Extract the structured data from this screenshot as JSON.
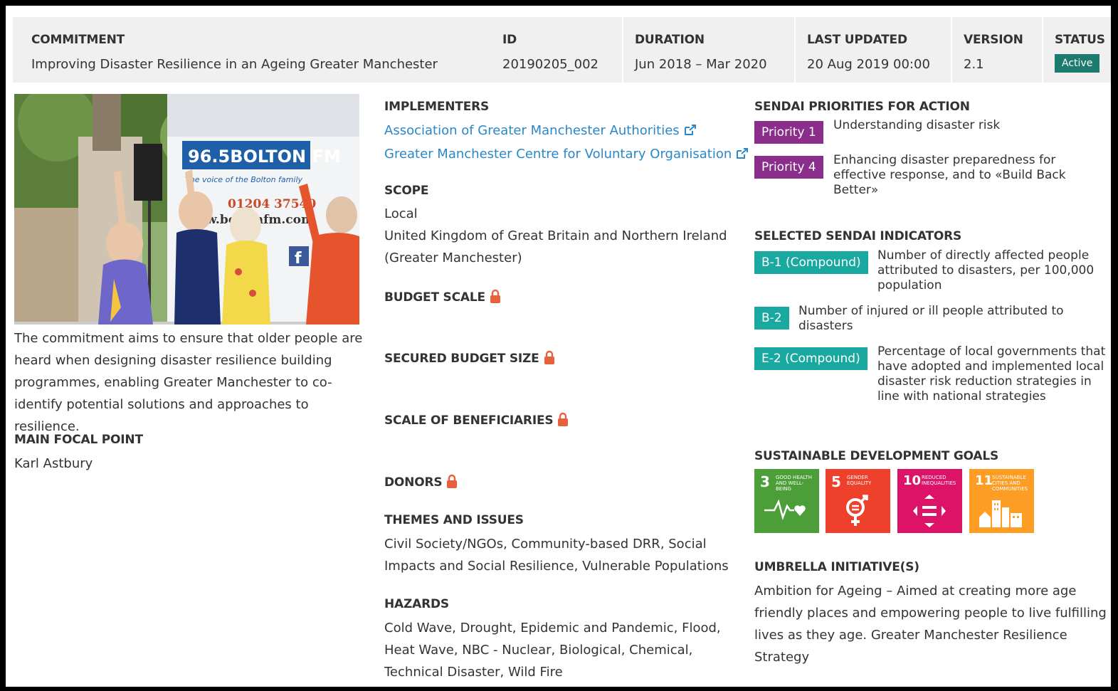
{
  "header": {
    "commitment_label": "COMMITMENT",
    "commitment_value": "Improving Disaster Resilience in an Ageing Greater Manchester",
    "id_label": "ID",
    "id_value": "20190205_002",
    "duration_label": "DURATION",
    "duration_value": "Jun 2018 – Mar 2020",
    "updated_label": "LAST UPDATED",
    "updated_value": "20 Aug 2019 00:00",
    "version_label": "VERSION",
    "version_value": "2.1",
    "status_label": "STATUS",
    "status_value": "Active"
  },
  "left": {
    "photo": {
      "banner_text": "96.5BOLTON FM",
      "banner_sub": "The voice of the Bolton family",
      "phone_text": "01204 37540",
      "web_text": "w.boltonfm.con"
    },
    "description": "The commitment aims to ensure that older people are heard when designing disaster resilience building programmes, enabling Greater Manchester to co-identify potential solutions and approaches to resilience.",
    "focal_label": "MAIN FOCAL POINT",
    "focal_value": "Karl Astbury"
  },
  "middle": {
    "implementers_label": "IMPLEMENTERS",
    "implementers": [
      "Association of Greater Manchester Authorities",
      "Greater Manchester Centre for Voluntary Organisation"
    ],
    "scope_label": "SCOPE",
    "scope_lines": [
      "Local",
      "United Kingdom of Great Britain and Northern Ireland",
      "(Greater Manchester)"
    ],
    "budget_scale_label": "BUDGET SCALE",
    "secured_budget_label": "SECURED BUDGET SIZE",
    "beneficiaries_label": "SCALE OF BENEFICIARIES",
    "donors_label": "DONORS",
    "themes_label": "THEMES AND ISSUES",
    "themes_value": "Civil Society/NGOs, Community-based DRR, Social Impacts and Social Resilience, Vulnerable Populations",
    "hazards_label": "HAZARDS",
    "hazards_value": "Cold Wave, Drought, Epidemic and Pandemic, Flood, Heat Wave, NBC - Nuclear, Biological, Chemical, Technical Disaster, Wild Fire"
  },
  "right": {
    "priorities_label": "SENDAI PRIORITIES FOR ACTION",
    "priorities": [
      {
        "badge": "Priority 1",
        "text": "Understanding disaster risk"
      },
      {
        "badge": "Priority 4",
        "text": "Enhancing disaster preparedness for effective response, and to «Build Back Better»"
      }
    ],
    "indicators_label": "SELECTED SENDAI INDICATORS",
    "indicators": [
      {
        "badge": "B-1 (Compound)",
        "text": "Number of directly affected people attributed to disasters, per 100,000 population"
      },
      {
        "badge": "B-2",
        "text": "Number of injured or ill people attributed to disasters"
      },
      {
        "badge": "E-2 (Compound)",
        "text": "Percentage of local governments that have adopted and implemented local disaster risk reduction strategies in line with national strategies"
      }
    ],
    "sdg_label": "SUSTAINABLE DEVELOPMENT GOALS",
    "sdgs": [
      {
        "num": "3",
        "title": "Good health and well-being",
        "color": "#4c9f38",
        "icon": "heartbeat-icon"
      },
      {
        "num": "5",
        "title": "Gender equality",
        "color": "#ef402b",
        "icon": "gender-equality-icon"
      },
      {
        "num": "10",
        "title": "Reduced inequalities",
        "color": "#dd1367",
        "icon": "inequality-arrows-icon"
      },
      {
        "num": "11",
        "title": "Sustainable cities and communities",
        "color": "#fd9d24",
        "icon": "city-buildings-icon"
      }
    ],
    "umbrella_label": "UMBRELLA INITIATIVE(S)",
    "umbrella_value": "Ambition for Ageing – Aimed at creating more age friendly places and empowering people to live fulfilling lives as they age. Greater Manchester Resilience Strategy"
  },
  "colors": {
    "header_bg": "#f0f0f0",
    "status": "#1d7a6e",
    "link": "#2a87c8",
    "priority_badge": "#8b2d8a",
    "indicator_badge": "#1aa9a0",
    "lock": "#e8603c"
  }
}
